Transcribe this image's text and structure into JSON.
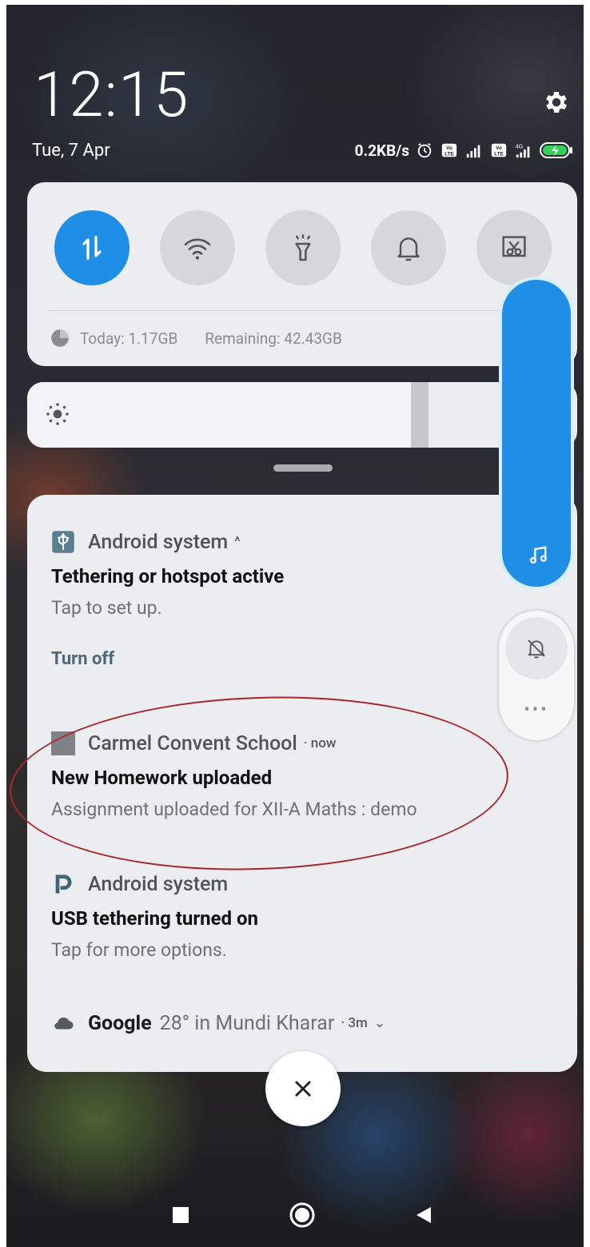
{
  "lockscreen": {
    "time": "12:15",
    "date": "Tue, 7 Apr"
  },
  "statusbar": {
    "speed": "0.2KB/s",
    "icons": [
      "alarm-icon",
      "volte-icon",
      "signal-icon",
      "volte-icon",
      "4g-signal-icon",
      "battery-charging-icon"
    ]
  },
  "quick_settings": {
    "tiles": [
      {
        "name": "mobile-data",
        "icon": "data-arrows-icon",
        "active": true
      },
      {
        "name": "wifi",
        "icon": "wifi-icon",
        "active": false
      },
      {
        "name": "flashlight",
        "icon": "flashlight-icon",
        "active": false
      },
      {
        "name": "sound",
        "icon": "bell-icon",
        "active": false
      },
      {
        "name": "screenshot",
        "icon": "scissors-icon",
        "active": false
      }
    ],
    "data_usage": {
      "today": "Today: 1.17GB",
      "remaining": "Remaining: 42.43GB"
    },
    "brightness_level": 0.84
  },
  "notifications": [
    {
      "app": "Android system",
      "icon": "usb-icon",
      "chevron": "^",
      "title": "Tethering or hotspot active",
      "text": "Tap to set up.",
      "action": "Turn off"
    },
    {
      "app": "Carmel Convent School",
      "icon": "app-square-icon",
      "time": "· now",
      "title": "New Homework uploaded",
      "text": "Assignment uploaded for XII-A Maths : demo"
    },
    {
      "app": "Android system",
      "icon": "p-icon",
      "title": "USB tethering turned on",
      "text": "Tap for more options."
    },
    {
      "app": "Google",
      "icon": "cloud-icon",
      "summary": "28° in Mundi Kharar",
      "time": "· 3m",
      "chevron": "⌄"
    }
  ],
  "volume": {
    "level": 1.0,
    "more_label": "•••"
  },
  "colors": {
    "accent": "#1e8ee6",
    "panel": "#ecedf0",
    "highlight_ring": "#a8262c"
  }
}
